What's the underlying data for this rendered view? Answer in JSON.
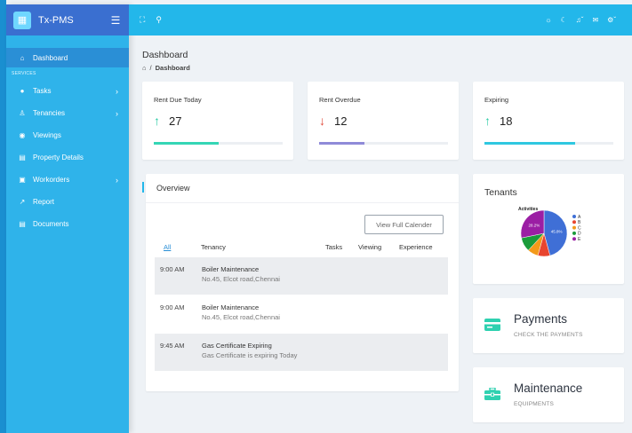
{
  "app": {
    "name": "Tx-PMS"
  },
  "sidebar": {
    "active": {
      "label": "Dashboard",
      "icon": "home-icon"
    },
    "section_label": "SERVICES",
    "items": [
      {
        "label": "Tasks",
        "icon": "circle-icon",
        "has_children": true
      },
      {
        "label": "Tenancies",
        "icon": "user-icon",
        "has_children": true
      },
      {
        "label": "Viewings",
        "icon": "eye-icon",
        "has_children": false
      },
      {
        "label": "Property Details",
        "icon": "document-icon",
        "has_children": false
      },
      {
        "label": "Workorders",
        "icon": "toolbox-icon",
        "has_children": true
      },
      {
        "label": "Report",
        "icon": "trend-icon",
        "has_children": false
      },
      {
        "label": "Documents",
        "icon": "document-icon",
        "has_children": false
      }
    ]
  },
  "page": {
    "title": "Dashboard",
    "breadcrumb": [
      "Dashboard"
    ]
  },
  "stats": [
    {
      "title": "Rent Due Today",
      "value": "27",
      "direction": "up",
      "progress": 0.5,
      "color": "#34d6b5"
    },
    {
      "title": "Rent Overdue",
      "value": "12",
      "direction": "down",
      "progress": 0.35,
      "color": "#8f8ad8"
    },
    {
      "title": "Expiring",
      "value": "18",
      "direction": "up",
      "progress": 0.7,
      "color": "#2fc8e0"
    }
  ],
  "overview": {
    "title": "Overview",
    "button": "View Full Calender",
    "columns": [
      "All",
      "Tenancy",
      "Tasks",
      "Viewing",
      "Experience"
    ],
    "rows": [
      {
        "time": "9:00 AM",
        "title": "Boiler Maintenance",
        "subtitle": "No.45, Elcot road,Chennai"
      },
      {
        "time": "9:00 AM",
        "title": "Boiler Maintenance",
        "subtitle": "No.45, Elcot road,Chennai"
      },
      {
        "time": "9:45 AM",
        "title": "Gas Certificate Expiring",
        "subtitle": "Gas Certificate is expiring Today"
      }
    ]
  },
  "tenants": {
    "title": "Tenants",
    "chart_title": "Activities"
  },
  "chart_data": {
    "type": "pie",
    "title": "Activities",
    "categories": [
      "A",
      "B",
      "C",
      "D",
      "E"
    ],
    "values": [
      45.8,
      8.5,
      7.6,
      9.9,
      28.2
    ],
    "colors": [
      "#3f6fd6",
      "#e8452f",
      "#f39a1a",
      "#1a9b3a",
      "#9b1ea4"
    ],
    "labels": [
      "45.8%",
      "",
      "",
      "",
      "28.2%"
    ],
    "legend": "right"
  },
  "payments": {
    "title": "Payments",
    "subtitle": "CHECK THE PAYMENTS",
    "icon": "credit-card-icon"
  },
  "maintenance": {
    "title": "Maintenance",
    "subtitle": "EQUIPMENTS",
    "icon": "toolbox-icon"
  }
}
